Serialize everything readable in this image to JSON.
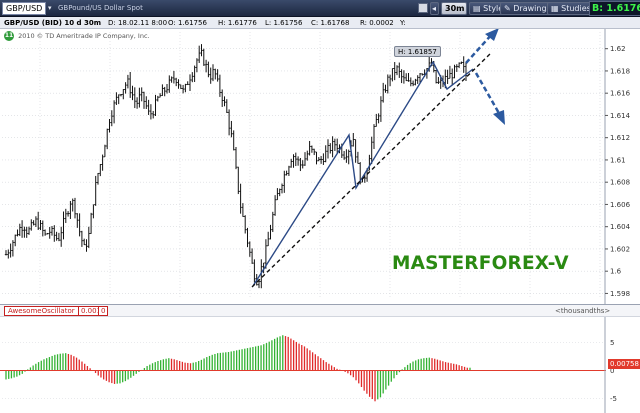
{
  "toolbar": {
    "symbol": "GBP/USD",
    "description": "GBPound/US Dollar Spot",
    "timeframe": "30m",
    "style_label": "Style",
    "drawings_label": "Drawings",
    "studies_label": "Studies",
    "price_prefix": "B:",
    "price_value": "1.6176"
  },
  "info_bar": {
    "symbol_spec": "GBP/USD (BID) 10 d 30m",
    "date": "D: 18.02.11 8:00",
    "open": "O: 1.61756",
    "high": "H: 1.61776",
    "low": "L: 1.61756",
    "close": "C: 1.61768",
    "range": "R: 0.0002",
    "y_label": "Y:"
  },
  "chart": {
    "copyright": "2010 © TD Ameritrade IP Company, Inc.",
    "badge_text": "11",
    "high_label": "H: 1.61857",
    "watermark": "MASTERFOREX-V",
    "colors": {
      "candle": "#111111",
      "pattern_line": "#2c4a86",
      "trend_line": "#111111",
      "arrow": "#2c5aa0",
      "watermark": "#2a8a12",
      "grid": "#d3d6db"
    }
  },
  "chart_data": [
    {
      "type": "bar",
      "title": "GBP/USD (BID) 10 d 30m",
      "y_ticks": [
        "1.62",
        "1.618",
        "1.616",
        "1.614",
        "1.612",
        "1.61",
        "1.608",
        "1.606",
        "1.604",
        "1.602",
        "1.6",
        "1.598"
      ],
      "ylim": [
        1.5975,
        1.6215
      ],
      "grid": true,
      "annotations": [
        "H: 1.61857",
        "MASTERFOREX-V"
      ],
      "close_path": [
        1.6015,
        1.6022,
        1.603,
        1.6038,
        1.6042,
        1.6035,
        1.604,
        1.6045,
        1.6039,
        1.6032,
        1.6036,
        1.6033,
        1.6028,
        1.604,
        1.6052,
        1.6065,
        1.6055,
        1.6035,
        1.602,
        1.603,
        1.606,
        1.6085,
        1.61,
        1.612,
        1.614,
        1.615,
        1.616,
        1.6165,
        1.617,
        1.616,
        1.615,
        1.6158,
        1.6152,
        1.614,
        1.6145,
        1.6155,
        1.616,
        1.6165,
        1.617,
        1.6175,
        1.6168,
        1.616,
        1.6172,
        1.618,
        1.619,
        1.6195,
        1.6185,
        1.6175,
        1.618,
        1.6165,
        1.6155,
        1.614,
        1.612,
        1.609,
        1.606,
        1.604,
        1.602,
        1.6,
        1.599,
        1.6005,
        1.602,
        1.604,
        1.606,
        1.6075,
        1.6085,
        1.6095,
        1.6105,
        1.61,
        1.6095,
        1.6102,
        1.611,
        1.6105,
        1.6098,
        1.6102,
        1.6108,
        1.6112,
        1.6115,
        1.611,
        1.6105,
        1.611,
        1.612,
        1.6095,
        1.6078,
        1.609,
        1.611,
        1.613,
        1.6145,
        1.616,
        1.6172,
        1.6178,
        1.6182,
        1.6175,
        1.617,
        1.6168,
        1.6172,
        1.6178,
        1.618,
        1.6182,
        1.6186,
        1.617,
        1.6168,
        1.6172,
        1.6175,
        1.6178,
        1.6182,
        1.6185,
        1.6176
      ]
    },
    {
      "type": "bar",
      "title": "AwesomeOscillator",
      "y_ticks": [
        "5",
        "0",
        "-5"
      ],
      "current_label": "0.00758",
      "units_label": "<thousandths>",
      "values": [
        -1.6,
        -1.4,
        -1.1,
        -0.6,
        0.2,
        0.9,
        1.5,
        2.0,
        2.4,
        2.8,
        3.0,
        3.1,
        2.8,
        2.3,
        1.6,
        0.8,
        0.0,
        -0.9,
        -1.6,
        -2.1,
        -2.4,
        -2.3,
        -1.9,
        -1.3,
        -0.6,
        0.1,
        0.8,
        1.3,
        1.7,
        2.0,
        2.2,
        2.0,
        1.7,
        1.4,
        1.3,
        1.5,
        1.9,
        2.4,
        2.8,
        3.1,
        3.2,
        3.3,
        3.5,
        3.7,
        3.9,
        4.1,
        4.3,
        4.5,
        4.9,
        5.4,
        5.9,
        6.3,
        6.0,
        5.4,
        4.8,
        4.3,
        3.6,
        2.9,
        2.2,
        1.5,
        0.9,
        0.3,
        0.0,
        -0.5,
        -1.2,
        -2.3,
        -3.6,
        -4.7,
        -5.5,
        -4.8,
        -3.4,
        -2.0,
        -0.8,
        0.2,
        1.0,
        1.6,
        2.0,
        2.2,
        2.3,
        2.1,
        1.8,
        1.5,
        1.3,
        1.1,
        0.8,
        0.5
      ]
    }
  ]
}
